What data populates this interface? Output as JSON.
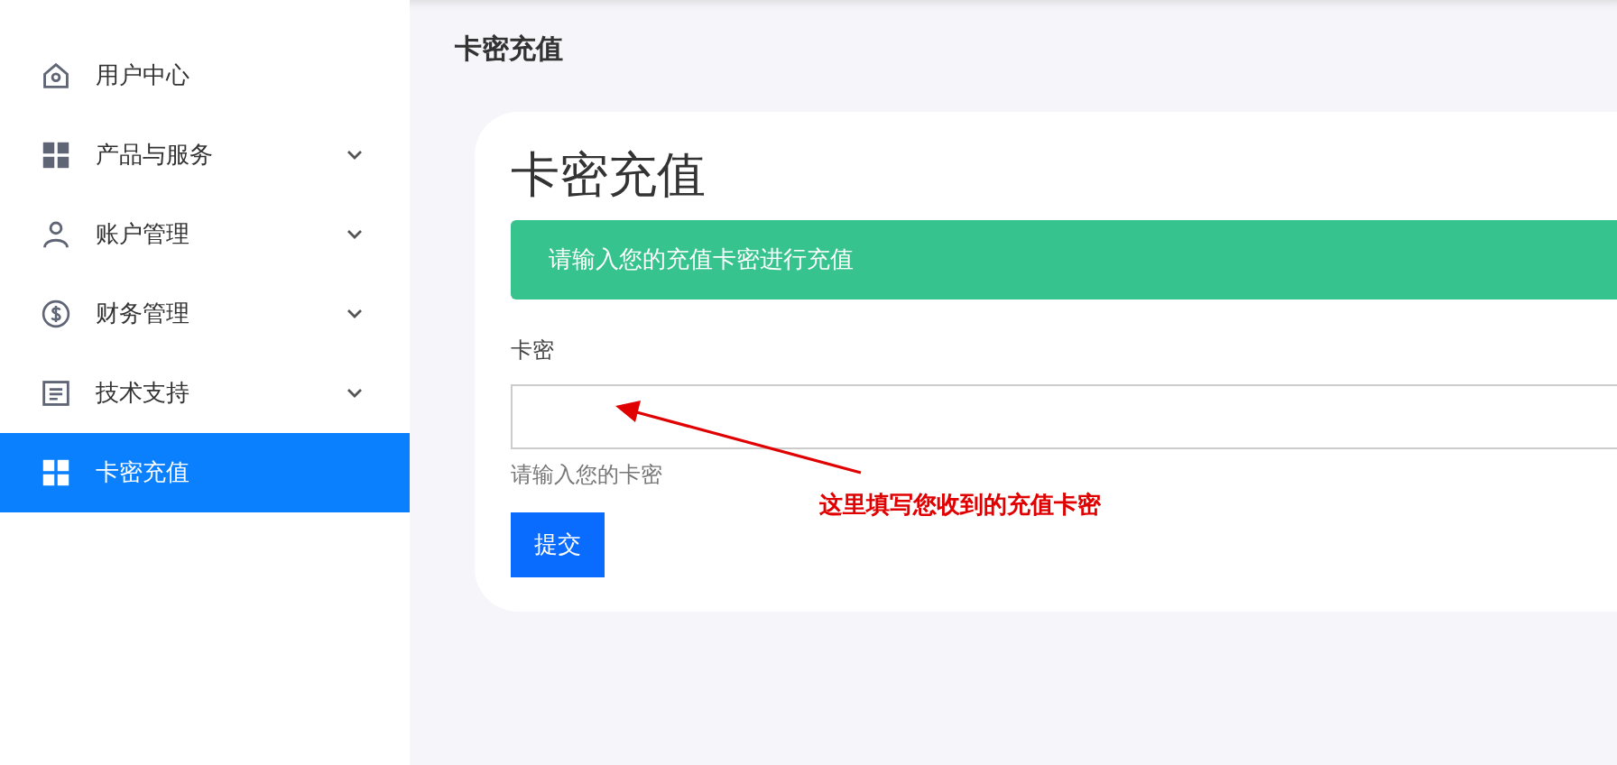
{
  "sidebar": {
    "items": [
      {
        "label": "用户中心",
        "expandable": false,
        "selected": false
      },
      {
        "label": "产品与服务",
        "expandable": true,
        "selected": false
      },
      {
        "label": "账户管理",
        "expandable": true,
        "selected": false
      },
      {
        "label": "财务管理",
        "expandable": true,
        "selected": false
      },
      {
        "label": "技术支持",
        "expandable": true,
        "selected": false
      },
      {
        "label": "卡密充值",
        "expandable": false,
        "selected": true
      }
    ]
  },
  "page_title": "卡密充值",
  "card": {
    "heading": "卡密充值",
    "alert": "请输入您的充值卡密进行充值",
    "field_label": "卡密",
    "help": "请输入您的卡密",
    "button": "提交"
  },
  "annotation": {
    "text": "这里填写您收到的充值卡密"
  }
}
